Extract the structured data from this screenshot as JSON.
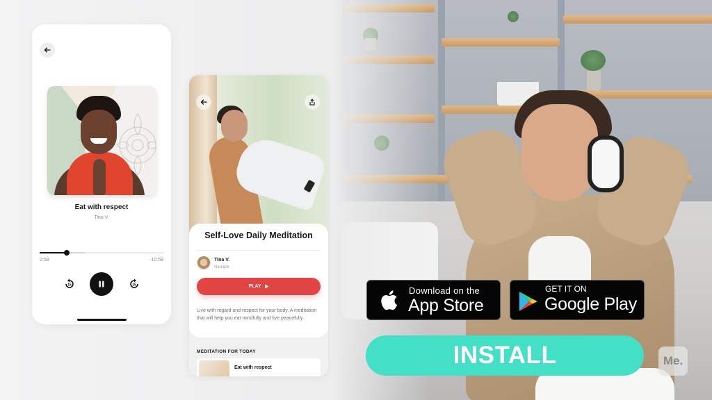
{
  "player_screen": {
    "back_icon": "arrow-left-icon",
    "track_title": "Eat with respect",
    "track_artist": "Tina V.",
    "elapsed": "2:58",
    "remaining": "-10:59",
    "progress_fraction": 0.22,
    "buffered_fraction": 0.37,
    "rewind_icon": "rewind-15-icon",
    "rewind_label": "15",
    "pause_icon": "pause-icon",
    "forward_icon": "forward-15-icon",
    "forward_label": "15"
  },
  "detail_screen": {
    "back_icon": "arrow-left-icon",
    "share_icon": "share-icon",
    "title": "Self-Love Daily Meditation",
    "narrator": {
      "name": "Tina V.",
      "role": "Narrator"
    },
    "play_label": "PLAY",
    "play_icon": "play-icon",
    "description": "Live with regard and respect for your body. A meditation that will help you eat mindfully and live peacefully.",
    "section_label": "MEDITATION FOR TODAY",
    "today_item": {
      "title": "Eat with respect"
    },
    "accent_color": "#e04443"
  },
  "promo": {
    "app_store": {
      "small": "Download on the",
      "big": "App Store",
      "icon": "apple-icon"
    },
    "google_play": {
      "small": "GET IT ON",
      "big": "Google Play",
      "icon": "google-play-icon"
    },
    "install_label": "INSTALL",
    "install_color": "#43dfc6",
    "brand_logo": "Me."
  }
}
